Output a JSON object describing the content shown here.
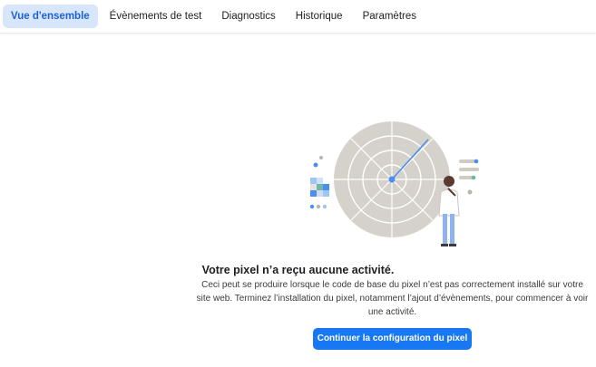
{
  "tabs": [
    {
      "label": "Vue d'ensemble",
      "active": true
    },
    {
      "label": "Évènements de test",
      "active": false
    },
    {
      "label": "Diagnostics",
      "active": false
    },
    {
      "label": "Historique",
      "active": false
    },
    {
      "label": "Paramètres",
      "active": false
    }
  ],
  "empty_state": {
    "illustration_icon": "radar-scientist-illustration",
    "title": "Votre pixel n’a reçu aucune activité.",
    "description": "Ceci peut se produire lorsque le code de base du pixel n’est pas correctement installé sur votre site web. Terminez l’installation du pixel, notamment l’ajout d’évènements, pour commencer à voir une activité.",
    "cta_label": "Continuer la configuration du pixel"
  },
  "colors": {
    "accent": "#1877f2",
    "active_tab_bg": "#d8e6fb",
    "active_tab_text": "#1b62d6"
  }
}
